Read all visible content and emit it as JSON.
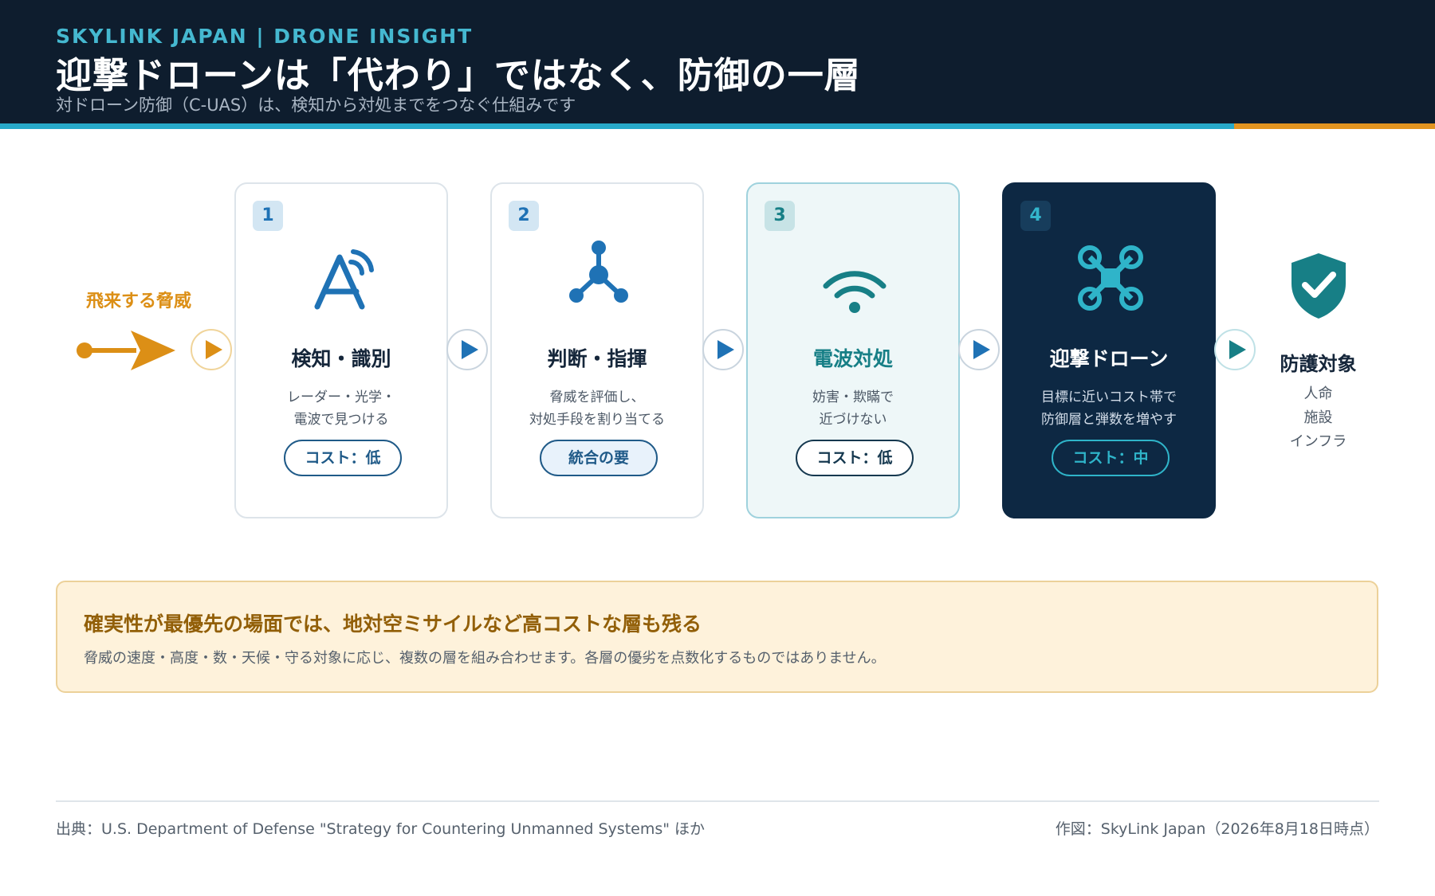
{
  "header": {
    "brand": "SKYLINK JAPAN | DRONE INSIGHT",
    "title": "迎撃ドローンは「代わり」ではなく、防御の一層",
    "subtitle": "対ドローン防御（C-UAS）は、検知から対処までをつなぐ仕組みです"
  },
  "threat": {
    "label": "飛来する脅威"
  },
  "steps": [
    {
      "number": "1",
      "icon": "radar-icon",
      "title": "検知・識別",
      "desc": [
        "レーダー・光学・",
        "電波で見つける"
      ],
      "tag": "コスト：低"
    },
    {
      "number": "2",
      "icon": "network-node-icon",
      "title": "判断・指揮",
      "desc": [
        "脅威を評価し、",
        "対処手段を割り当てる"
      ],
      "tag": "統合の要"
    },
    {
      "number": "3",
      "icon": "wifi-signal-icon",
      "title": "電波対処",
      "desc": [
        "妨害・欺瞞で",
        "近づけない"
      ],
      "tag": "コスト：低"
    },
    {
      "number": "4",
      "icon": "drone-icon",
      "title": "迎撃ドローン",
      "desc": [
        "目標に近いコスト帯で",
        "防御層と弾数を増やす"
      ],
      "tag": "コスト：中"
    }
  ],
  "target": {
    "icon": "shield-check-icon",
    "title": "防護対象",
    "items": [
      "人命",
      "施設",
      "インフラ"
    ]
  },
  "note": {
    "title": "確実性が最優先の場面では、地対空ミサイルなど高コストな層も残る",
    "text": "脅威の速度・高度・数・天候・守る対象に応じ、複数の層を組み合わせます。各層の優劣を点数化するものではありません。"
  },
  "footer": {
    "source": "出典：U.S. Department of Defense \"Strategy for Countering Unmanned Systems\" ほか",
    "credit": "作図：SkyLink Japan（2026年8月18日時点）"
  },
  "colors": {
    "navy": "#0e1d2e",
    "cyan_accent": "#27a9c9",
    "orange_accent": "#e29420",
    "blue": "#1f72b5",
    "teal": "#177f86",
    "note_bg": "#fef2db"
  }
}
